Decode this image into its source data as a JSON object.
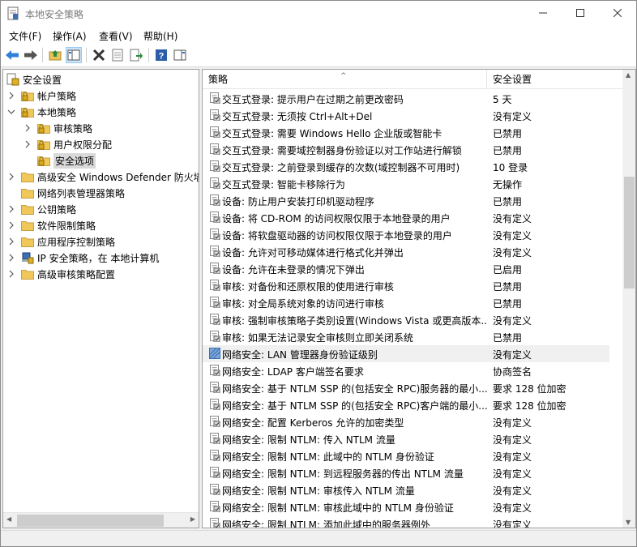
{
  "window": {
    "title": "本地安全策略",
    "controls": {
      "minimize": "—",
      "maximize": "☐",
      "close": "✕"
    }
  },
  "menu": [
    {
      "label": "文件(F)"
    },
    {
      "label": "操作(A)"
    },
    {
      "label": "查看(V)"
    },
    {
      "label": "帮助(H)"
    }
  ],
  "toolbar": {
    "icons": [
      "back-icon",
      "forward-icon",
      "up-folder-icon",
      "show-tree-icon",
      "delete-icon",
      "properties-icon",
      "export-list-icon",
      "help-icon",
      "show-action-pane-icon"
    ]
  },
  "tree": [
    {
      "label": "安全设置",
      "level": 0,
      "caret": "none",
      "icon": "security-settings"
    },
    {
      "label": "帐户策略",
      "level": 1,
      "caret": "›",
      "icon": "folder-lock"
    },
    {
      "label": "本地策略",
      "level": 1,
      "caret": "⌄",
      "icon": "folder-lock"
    },
    {
      "label": "审核策略",
      "level": 2,
      "caret": "›",
      "icon": "folder-lock"
    },
    {
      "label": "用户权限分配",
      "level": 2,
      "caret": "›",
      "icon": "folder-lock"
    },
    {
      "label": "安全选项",
      "level": 2,
      "caret": "none",
      "icon": "folder-lock",
      "selected": true
    },
    {
      "label": "高级安全 Windows Defender 防火墙",
      "level": 1,
      "caret": "›",
      "icon": "folder"
    },
    {
      "label": "网络列表管理器策略",
      "level": 1,
      "caret": "none",
      "icon": "folder"
    },
    {
      "label": "公钥策略",
      "level": 1,
      "caret": "›",
      "icon": "folder"
    },
    {
      "label": "软件限制策略",
      "level": 1,
      "caret": "›",
      "icon": "folder"
    },
    {
      "label": "应用程序控制策略",
      "level": 1,
      "caret": "›",
      "icon": "folder"
    },
    {
      "label": "IP 安全策略，在 本地计算机",
      "level": 1,
      "caret": "›",
      "icon": "ipsec"
    },
    {
      "label": "高级审核策略配置",
      "level": 1,
      "caret": "›",
      "icon": "folder"
    }
  ],
  "list": {
    "columns": {
      "policy": "策略",
      "setting": "安全设置"
    },
    "sort_indicator": "^",
    "rows": [
      {
        "policy": "交互式登录: 提示用户在过期之前更改密码",
        "setting": "5 天"
      },
      {
        "policy": "交互式登录: 无须按 Ctrl+Alt+Del",
        "setting": "没有定义"
      },
      {
        "policy": "交互式登录: 需要 Windows Hello 企业版或智能卡",
        "setting": "已禁用"
      },
      {
        "policy": "交互式登录: 需要域控制器身份验证以对工作站进行解锁",
        "setting": "已禁用"
      },
      {
        "policy": "交互式登录: 之前登录到缓存的次数(域控制器不可用时)",
        "setting": "10 登录"
      },
      {
        "policy": "交互式登录: 智能卡移除行为",
        "setting": "无操作"
      },
      {
        "policy": "设备: 防止用户安装打印机驱动程序",
        "setting": "已禁用"
      },
      {
        "policy": "设备: 将 CD-ROM 的访问权限仅限于本地登录的用户",
        "setting": "没有定义"
      },
      {
        "policy": "设备: 将软盘驱动器的访问权限仅限于本地登录的用户",
        "setting": "没有定义"
      },
      {
        "policy": "设备: 允许对可移动媒体进行格式化并弹出",
        "setting": "没有定义"
      },
      {
        "policy": "设备: 允许在未登录的情况下弹出",
        "setting": "已启用"
      },
      {
        "policy": "审核: 对备份和还原权限的使用进行审核",
        "setting": "已禁用"
      },
      {
        "policy": "审核: 对全局系统对象的访问进行审核",
        "setting": "已禁用"
      },
      {
        "policy": "审核: 强制审核策略子类别设置(Windows Vista 或更高版本...",
        "setting": "没有定义"
      },
      {
        "policy": "审核: 如果无法记录安全审核则立即关闭系统",
        "setting": "已禁用"
      },
      {
        "policy": "网络安全: LAN 管理器身份验证级别",
        "setting": "没有定义",
        "hover": true
      },
      {
        "policy": "网络安全: LDAP 客户端签名要求",
        "setting": "协商签名"
      },
      {
        "policy": "网络安全: 基于 NTLM SSP 的(包括安全 RPC)服务器的最小...",
        "setting": "要求 128 位加密"
      },
      {
        "policy": "网络安全: 基于 NTLM SSP 的(包括安全 RPC)客户端的最小...",
        "setting": "要求 128 位加密"
      },
      {
        "policy": "网络安全: 配置 Kerberos 允许的加密类型",
        "setting": "没有定义"
      },
      {
        "policy": "网络安全: 限制 NTLM: 传入 NTLM 流量",
        "setting": "没有定义"
      },
      {
        "policy": "网络安全: 限制 NTLM: 此域中的 NTLM 身份验证",
        "setting": "没有定义"
      },
      {
        "policy": "网络安全: 限制 NTLM: 到远程服务器的传出 NTLM 流量",
        "setting": "没有定义"
      },
      {
        "policy": "网络安全: 限制 NTLM: 审核传入 NTLM 流量",
        "setting": "没有定义"
      },
      {
        "policy": "网络安全: 限制 NTLM: 审核此域中的 NTLM 身份验证",
        "setting": "没有定义"
      },
      {
        "policy": "网络安全: 限制 NTLM: 添加此域中的服务器例外",
        "setting": "没有定义"
      }
    ]
  },
  "scrollbars": {
    "up_arrow": "▲",
    "down_arrow": "▼",
    "left_arrow": "◀",
    "right_arrow": "▶"
  }
}
